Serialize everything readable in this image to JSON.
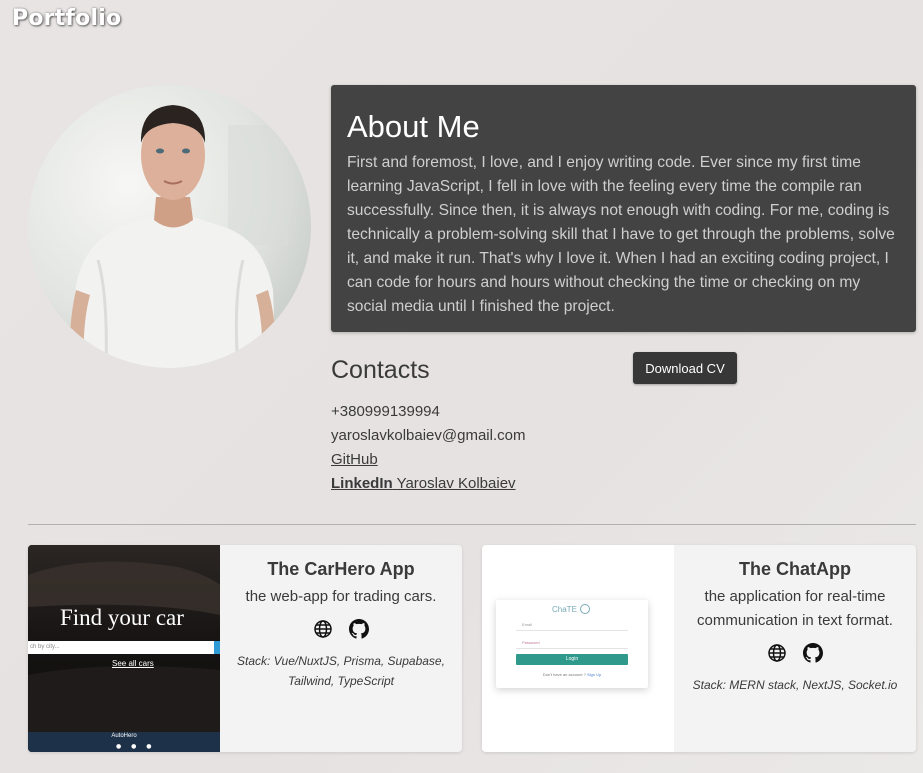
{
  "brand": "Portfolio",
  "about": {
    "title": "About Me",
    "text": "First and foremost, I love, and I enjoy writing code. Ever since my first time learning JavaScript, I fell in love with the feeling every time the compile ran successfully. Since then, it is always not enough with coding. For me, coding is technically a problem-solving skill that I have to get through the problems, solve it, and make it run. That's why I love it. When I had an exciting coding project, I can code for hours and hours without checking the time or checking on my social media until I finished the project."
  },
  "contacts": {
    "title": "Contacts",
    "phone": "+380999139994",
    "email": "yaroslavkolbaiev@gmail.com",
    "github": "GitHub",
    "linkedin_label": "LinkedIn",
    "linkedin_name": "Yaroslav Kolbaiev"
  },
  "download_button": "Download CV",
  "projects": [
    {
      "title": "The CarHero App",
      "description": "the web-app for trading cars.",
      "stack": "Stack: Vue/NuxtJS, Prisma, Supabase, Tailwind, TypeScript",
      "thumb": {
        "headline": "Find your car",
        "search_placeholder": "ch by city...",
        "see_all": "See all cars",
        "footer": "AutoHero"
      },
      "icons": [
        "globe-icon",
        "github-icon"
      ]
    },
    {
      "title": "The ChatApp",
      "description": "the application for real-time communication in text format.",
      "stack": "Stack: MERN stack, NextJS, Socket.io",
      "thumb": {
        "logo": "ChaTE",
        "email_label": "Email",
        "password_label": "Password",
        "login_button": "Login",
        "signup_prompt": "Don't have an account ?",
        "signup_link": "Sign Up"
      },
      "icons": [
        "globe-icon",
        "github-icon"
      ]
    }
  ],
  "colors": {
    "about_bg": "#444343",
    "button_bg": "#373737",
    "login_green": "#2f9a8c",
    "thumb_dark": "#1c1c1c"
  }
}
